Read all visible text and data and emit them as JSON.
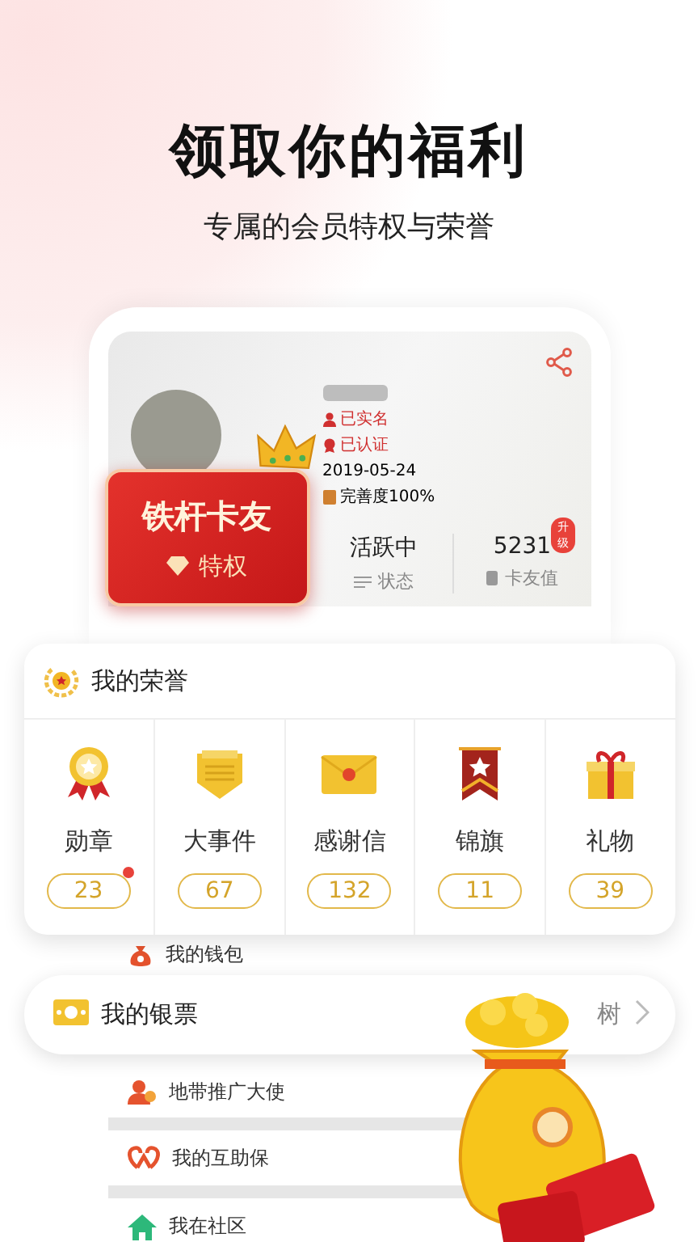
{
  "headline": "领取你的福利",
  "subtitle": "专属的会员特权与荣誉",
  "profile": {
    "badges": [
      {
        "kind": "verified",
        "label": "已实名"
      },
      {
        "kind": "certified",
        "label": "已认证"
      },
      {
        "kind": "date",
        "label": "2019-05-24"
      },
      {
        "kind": "completion",
        "label": "完善度100%"
      }
    ],
    "stats": [
      {
        "kind": "status",
        "value": "活跃中",
        "label": "状态"
      },
      {
        "kind": "points",
        "value": "5231",
        "badge": "升级",
        "label": "卡友值"
      }
    ]
  },
  "vip_card": {
    "title": "铁杆卡友",
    "subtitle": "特权"
  },
  "honors": {
    "title": "我的荣誉",
    "items": [
      {
        "kind": "medal",
        "label": "勋章",
        "count": "23",
        "unread": true
      },
      {
        "kind": "event",
        "label": "大事件",
        "count": "67",
        "unread": false
      },
      {
        "kind": "letter",
        "label": "感谢信",
        "count": "132",
        "unread": false
      },
      {
        "kind": "banner",
        "label": "锦旗",
        "count": "11",
        "unread": false
      },
      {
        "kind": "gift",
        "label": "礼物",
        "count": "39",
        "unread": false
      }
    ]
  },
  "menu_upper": [
    {
      "kind": "wallet",
      "label": "我的钱包"
    }
  ],
  "silver_ticket": {
    "label": "我的银票",
    "trailing": "树"
  },
  "menu_lower": [
    {
      "kind": "ambassador",
      "label": "地带推广大使"
    },
    {
      "kind": "insurance",
      "label": "我的互助保"
    },
    {
      "kind": "community",
      "label": "我在社区"
    }
  ]
}
